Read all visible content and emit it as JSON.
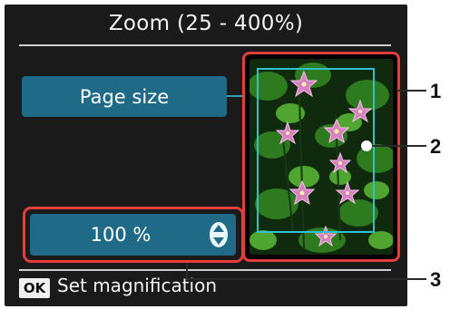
{
  "screen": {
    "title": "Zoom (25 - 400%)",
    "page_size_button": "Page size",
    "magnification": {
      "value": "100 %",
      "spinner_icon": "up-down-arrows-icon"
    },
    "footer": {
      "ok_label": "OK",
      "hint": "Set magnification"
    }
  },
  "callouts": [
    "1",
    "2",
    "3"
  ],
  "colors": {
    "panel_background": "#1a1a1a",
    "field_teal": "#1f6a86",
    "highlight_red": "#e23e3e",
    "zoom_box_cyan": "#2fc2d1"
  }
}
